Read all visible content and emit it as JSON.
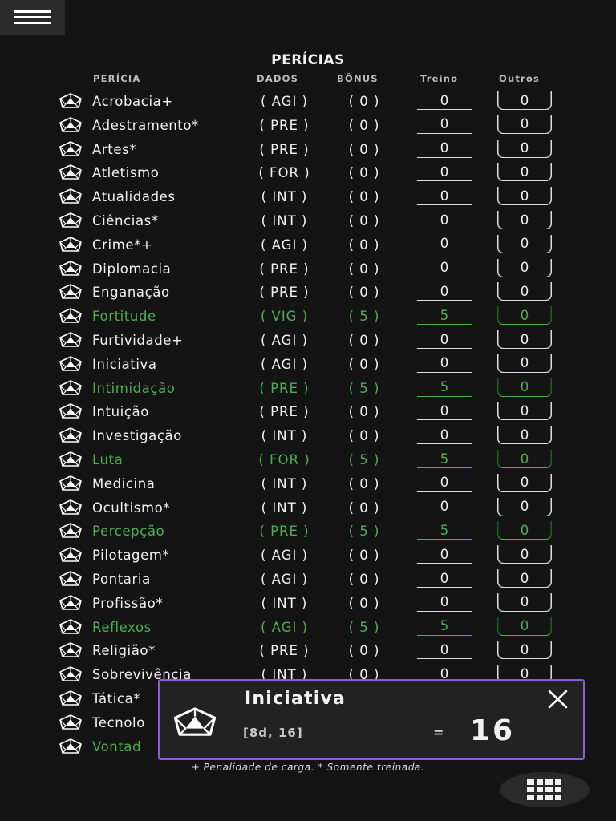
{
  "header": {
    "title": "PERÍCIAS"
  },
  "columns": {
    "pericia": "PERÍCIA",
    "dados": "DADOS",
    "bonus": "BÔNUS",
    "treino": "Treino",
    "outros": "Outros"
  },
  "skills": [
    {
      "name": "Acrobacia+",
      "attr": "( AGI )",
      "bonus": "( 0 )",
      "treino": "0",
      "outros": "0",
      "trained": false
    },
    {
      "name": "Adestramento*",
      "attr": "( PRE )",
      "bonus": "( 0 )",
      "treino": "0",
      "outros": "0",
      "trained": false
    },
    {
      "name": "Artes*",
      "attr": "( PRE )",
      "bonus": "( 0 )",
      "treino": "0",
      "outros": "0",
      "trained": false
    },
    {
      "name": "Atletismo",
      "attr": "( FOR )",
      "bonus": "( 0 )",
      "treino": "0",
      "outros": "0",
      "trained": false
    },
    {
      "name": "Atualidades",
      "attr": "( INT )",
      "bonus": "( 0 )",
      "treino": "0",
      "outros": "0",
      "trained": false
    },
    {
      "name": "Ciências*",
      "attr": "( INT )",
      "bonus": "( 0 )",
      "treino": "0",
      "outros": "0",
      "trained": false
    },
    {
      "name": "Crime*+",
      "attr": "( AGI )",
      "bonus": "( 0 )",
      "treino": "0",
      "outros": "0",
      "trained": false
    },
    {
      "name": "Diplomacia",
      "attr": "( PRE )",
      "bonus": "( 0 )",
      "treino": "0",
      "outros": "0",
      "trained": false
    },
    {
      "name": "Enganação",
      "attr": "( PRE )",
      "bonus": "( 0 )",
      "treino": "0",
      "outros": "0",
      "trained": false
    },
    {
      "name": "Fortitude",
      "attr": "( VIG )",
      "bonus": "( 5 )",
      "treino": "5",
      "outros": "0",
      "trained": true
    },
    {
      "name": "Furtividade+",
      "attr": "( AGI )",
      "bonus": "( 0 )",
      "treino": "0",
      "outros": "0",
      "trained": false
    },
    {
      "name": "Iniciativa",
      "attr": "( AGI )",
      "bonus": "( 0 )",
      "treino": "0",
      "outros": "0",
      "trained": false
    },
    {
      "name": "Intimidação",
      "attr": "( PRE )",
      "bonus": "( 5 )",
      "treino": "5",
      "outros": "0",
      "trained": true
    },
    {
      "name": "Intuição",
      "attr": "( PRE )",
      "bonus": "( 0 )",
      "treino": "0",
      "outros": "0",
      "trained": false
    },
    {
      "name": "Investigação",
      "attr": "( INT )",
      "bonus": "( 0 )",
      "treino": "0",
      "outros": "0",
      "trained": false
    },
    {
      "name": "Luta",
      "attr": "( FOR )",
      "bonus": "( 5 )",
      "treino": "5",
      "outros": "0",
      "trained": true
    },
    {
      "name": "Medicina",
      "attr": "( INT )",
      "bonus": "( 0 )",
      "treino": "0",
      "outros": "0",
      "trained": false
    },
    {
      "name": "Ocultismo*",
      "attr": "( INT )",
      "bonus": "( 0 )",
      "treino": "0",
      "outros": "0",
      "trained": false
    },
    {
      "name": "Percepção",
      "attr": "( PRE )",
      "bonus": "( 5 )",
      "treino": "5",
      "outros": "0",
      "trained": true
    },
    {
      "name": "Pilotagem*",
      "attr": "( AGI )",
      "bonus": "( 0 )",
      "treino": "0",
      "outros": "0",
      "trained": false
    },
    {
      "name": "Pontaria",
      "attr": "( AGI )",
      "bonus": "( 0 )",
      "treino": "0",
      "outros": "0",
      "trained": false
    },
    {
      "name": "Profissão*",
      "attr": "( INT )",
      "bonus": "( 0 )",
      "treino": "0",
      "outros": "0",
      "trained": false
    },
    {
      "name": "Reflexos",
      "attr": "( AGI )",
      "bonus": "( 5 )",
      "treino": "5",
      "outros": "0",
      "trained": true
    },
    {
      "name": "Religião*",
      "attr": "( PRE )",
      "bonus": "( 0 )",
      "treino": "0",
      "outros": "0",
      "trained": false
    },
    {
      "name": "Sobrevivência",
      "attr": "( INT )",
      "bonus": "( 0 )",
      "treino": "0",
      "outros": "0",
      "trained": false
    },
    {
      "name": "Tática*",
      "attr": "",
      "bonus": "",
      "treino": "",
      "outros": "",
      "trained": false
    },
    {
      "name": "Tecnolo",
      "attr": "",
      "bonus": "",
      "treino": "",
      "outros": "",
      "trained": false
    },
    {
      "name": "Vontad",
      "attr": "",
      "bonus": "",
      "treino": "",
      "outros": "",
      "trained": true
    }
  ],
  "footnote": "+ Penalidade de carga. * Somente treinada.",
  "roll_popup": {
    "title": "Iniciativa",
    "formula": "[8d, 16]",
    "equals": "=",
    "total": "16"
  },
  "colors": {
    "background": "#141414",
    "trained": "#4caf50",
    "popup_border": "#8f5bd6",
    "popup_bg": "#222222"
  },
  "icons": {
    "menu": "hamburger-menu-icon",
    "die": "d20-icon",
    "close": "close-icon",
    "grid": "grid-menu-icon"
  }
}
